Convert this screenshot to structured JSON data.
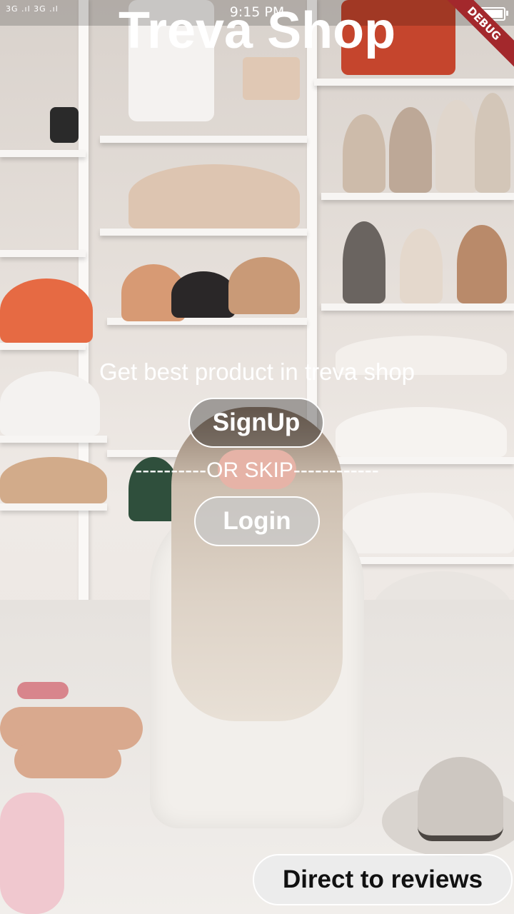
{
  "status_bar": {
    "network": "3G .ıl 3G .ıl",
    "time": "9:15 PM",
    "debug_banner": "DEBUG"
  },
  "app": {
    "title": "Treva Shop",
    "tagline": "Get best product in treva shop",
    "signup_label": "SignUp",
    "divider_text": "----------OR SKIP------------",
    "login_label": "Login",
    "reviews_label": "Direct to reviews"
  },
  "colors": {
    "debug_banner": "#a3282c",
    "text": "#ffffff",
    "reviews_text": "#111111"
  }
}
